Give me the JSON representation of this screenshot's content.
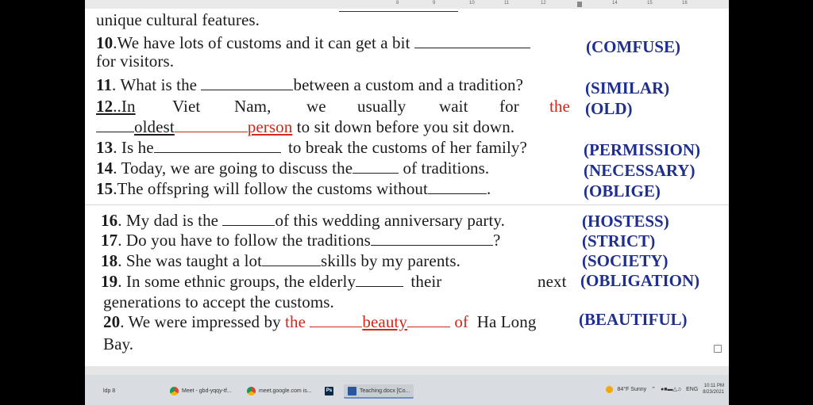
{
  "ruler": {
    "ticks": [
      "8",
      "9",
      "10",
      "11",
      "12",
      "14",
      "15",
      "16"
    ]
  },
  "doc": {
    "line_top": "unique cultural features.",
    "q10": {
      "num": "10",
      "text_a": ".We have lots of customs and it can get a bit",
      "text_b": "for visitors.",
      "answer": "(COMFUSE)"
    },
    "q11": {
      "num": "11",
      "text_a": ". What is the",
      "text_b": "between a custom and a tradition?",
      "answer": "(SIMILAR)"
    },
    "q12": {
      "num": "12",
      "text_a": "..In",
      "w1": "Viet",
      "w2": "Nam,",
      "w3": "we",
      "w4": "usually",
      "w5": "wait",
      "w6": "for",
      "w7": "the",
      "answer": "(OLD)",
      "fill1": "oldest",
      "fill2": "person",
      "text_b": "to sit down before you sit down."
    },
    "q13": {
      "num": "13",
      "text_a": ". Is he",
      "text_b": "to break the customs of her family?",
      "answer": "(PERMISSION)"
    },
    "q14": {
      "num": "14",
      "text_a": ". Today, we are going to discuss the",
      "text_b": "of traditions.",
      "answer": "(NECESSARY)"
    },
    "q15": {
      "num": "15",
      "text_a": ".The offspring will follow the customs without",
      "text_b": ".",
      "answer": "(OBLIGE)"
    },
    "q16": {
      "num": "16",
      "text_a": ". My dad is the",
      "text_b": "of this wedding anniversary party.",
      "answer": "(HOSTESS)"
    },
    "q17": {
      "num": "17",
      "text_a": ". Do you have to follow the traditions",
      "text_b": "?",
      "answer": "(STRICT)"
    },
    "q18": {
      "num": "18",
      "text_a": ". She was taught a lot",
      "text_b": "skills by my parents.",
      "answer": "(SOCIETY)"
    },
    "q19": {
      "num": "19",
      "text_a": ". In some ethnic groups, the elderly",
      "text_b": "their",
      "text_c": "next",
      "text_d": "generations to accept the customs.",
      "answer": "(OBLIGATION)"
    },
    "q20": {
      "num": "20",
      "text_a": ". We were impressed by",
      "red_the": "the",
      "fill": "beauty",
      "red_of": "of",
      "text_b": "Ha Long",
      "text_c": "Bay.",
      "answer": "(BEAUTIFUL)"
    }
  },
  "taskbar": {
    "items": [
      {
        "label": "ldp 8"
      },
      {
        "label": "Meet - gbd-yqqy-tf..."
      },
      {
        "label": "meet.google.com is..."
      },
      {
        "label": "Ps"
      },
      {
        "label": "Teaching.docx [Co..."
      }
    ],
    "weather": "84°F Sunny",
    "lang": "ENG",
    "time": "10:11 PM",
    "date": "8/23/2021"
  }
}
